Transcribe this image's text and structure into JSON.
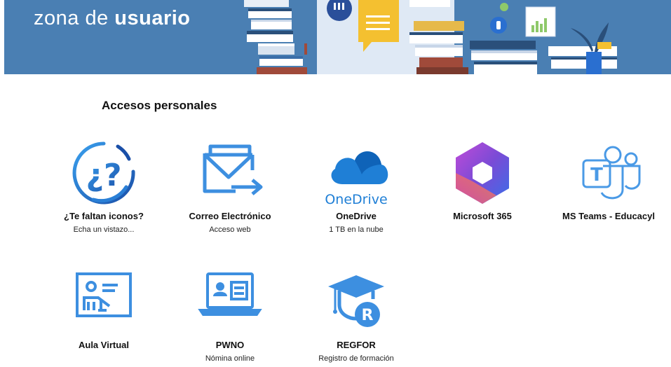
{
  "banner": {
    "title_regular": "zona de",
    "title_bold": "usuario"
  },
  "section": {
    "title": "Accesos personales"
  },
  "tiles": [
    {
      "name": "¿Te faltan iconos?",
      "sub": "Echa un vistazo...",
      "icon": "question-marks-icon"
    },
    {
      "name": "Correo Electrónico",
      "sub": "Acceso web",
      "icon": "mail-forward-icon"
    },
    {
      "name": "OneDrive",
      "sub": "1 TB en la nube",
      "icon": "onedrive-cloud-icon",
      "logo_text": "OneDrive"
    },
    {
      "name": "Microsoft 365",
      "sub": "",
      "icon": "microsoft-365-icon"
    },
    {
      "name": "MS Teams - Educacyl",
      "sub": "",
      "icon": "teams-icon"
    },
    {
      "name": "Aula Virtual",
      "sub": "",
      "icon": "virtual-classroom-icon"
    },
    {
      "name": "PWNO",
      "sub": "Nómina online",
      "icon": "payroll-id-card-icon"
    },
    {
      "name": "REGFOR",
      "sub": "Registro de formación",
      "icon": "graduation-registry-icon"
    }
  ],
  "colors": {
    "banner": "#4a7fb3",
    "icon_blue": "#3d8fe0",
    "onedrive_blue": "#1f7fd6"
  }
}
